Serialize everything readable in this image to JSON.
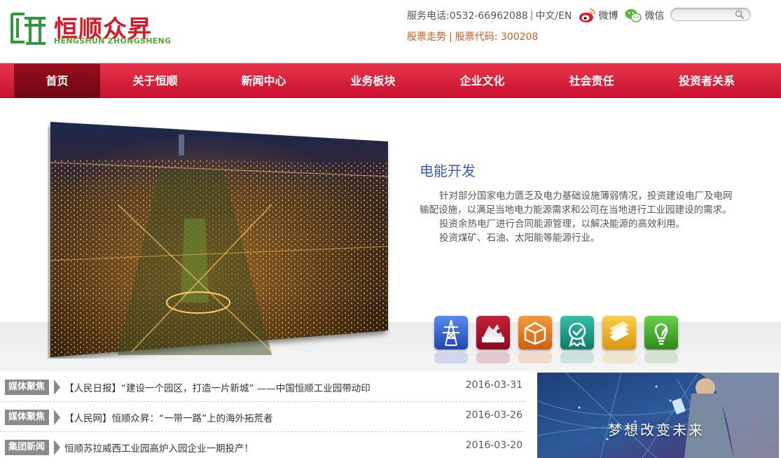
{
  "header": {
    "logo_cn": "恒顺众昇",
    "logo_en": "HENGSHUN ZHONGSHENG",
    "service_phone": "服务电话:0532-66962088",
    "language": "中文/EN",
    "weibo_label": "微博",
    "wechat_label": "微信",
    "search_placeholder": "",
    "stock_trend": "股票走势",
    "stock_code": "股票代码: 300208"
  },
  "nav": {
    "items": [
      {
        "label": "首页",
        "active": true
      },
      {
        "label": "关于恒顺"
      },
      {
        "label": "新闻中心"
      },
      {
        "label": "业务板块"
      },
      {
        "label": "企业文化"
      },
      {
        "label": "社会责任"
      },
      {
        "label": "投资者关系"
      }
    ]
  },
  "feature": {
    "title": "电能开发",
    "paragraphs": [
      "针对部分国家电力匮乏及电力基础设施薄弱情况，投资建设电厂及电网输配设施，以满足当地电力能源需求和公司在当地进行工业园建设的需求。",
      "投资余热电厂进行合同能源管理，以解决能源的高效利用。",
      "投资煤矿、石油、太阳能等能源行业。"
    ]
  },
  "categories": [
    {
      "icon": "power-tower-icon",
      "color": "#2f5fd0"
    },
    {
      "icon": "industry-icon",
      "color": "#a8112a"
    },
    {
      "icon": "box-icon",
      "color": "#e8731c"
    },
    {
      "icon": "certificate-icon",
      "color": "#1a9a8a"
    },
    {
      "icon": "money-icon",
      "color": "#e8b21c"
    },
    {
      "icon": "eco-bulb-icon",
      "color": "#4aaa2a"
    }
  ],
  "news": [
    {
      "tag": "媒体聚焦",
      "title": "【人民日报】“建设一个园区，打造一片新城” ——中国恒顺工业园带动印",
      "date": "2016-03-31"
    },
    {
      "tag": "媒体聚焦",
      "title": "【人民网】恒顺众昇：“一带一路”上的海外拓荒者",
      "date": "2016-03-26"
    },
    {
      "tag": "集团新闻",
      "title": "恒顺苏拉威西工业园高炉入园企业一期投产！",
      "date": "2016-03-20"
    }
  ],
  "promo": {
    "text": "梦想改变未来"
  },
  "colors": {
    "brand_red": "#d7192a",
    "nav_active": "#7a0814",
    "link_blue": "#3a5db8",
    "stock_orange": "#d65a1f"
  }
}
